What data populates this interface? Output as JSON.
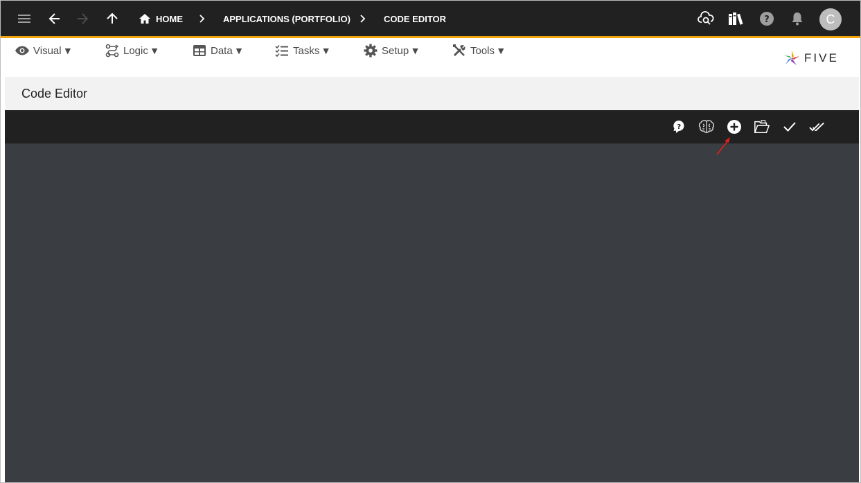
{
  "topbar": {
    "breadcrumbs": [
      "HOME",
      "APPLICATIONS (PORTFOLIO)",
      "CODE EDITOR"
    ],
    "icons": [
      "menu-icon",
      "back-arrow-icon",
      "forward-arrow-icon",
      "up-arrow-icon",
      "home-icon",
      "cloud-search-icon",
      "library-icon",
      "help-icon",
      "bell-icon"
    ],
    "avatar_initial": "C"
  },
  "menubar": {
    "items": [
      {
        "label": "Visual",
        "icon": "eye-icon"
      },
      {
        "label": "Logic",
        "icon": "logic-icon"
      },
      {
        "label": "Data",
        "icon": "table-icon"
      },
      {
        "label": "Tasks",
        "icon": "checklist-icon"
      },
      {
        "label": "Setup",
        "icon": "gear-icon"
      },
      {
        "label": "Tools",
        "icon": "tools-icon"
      }
    ],
    "caret": "▼"
  },
  "logo": {
    "text": "FIVE"
  },
  "page": {
    "title": "Code Editor"
  },
  "editor": {
    "toolbar_icons": [
      "help-bubble-icon",
      "brain-icon",
      "add-circle-icon",
      "open-folder-icon",
      "check-icon",
      "double-check-icon"
    ],
    "highlighted_icon": "add-circle-icon"
  },
  "colors": {
    "topbar": "#212121",
    "accent": "#f0a30a",
    "editor_background": "#3a3d41",
    "page_header": "#f2f2f2",
    "annotation_arrow": "#e02020"
  }
}
